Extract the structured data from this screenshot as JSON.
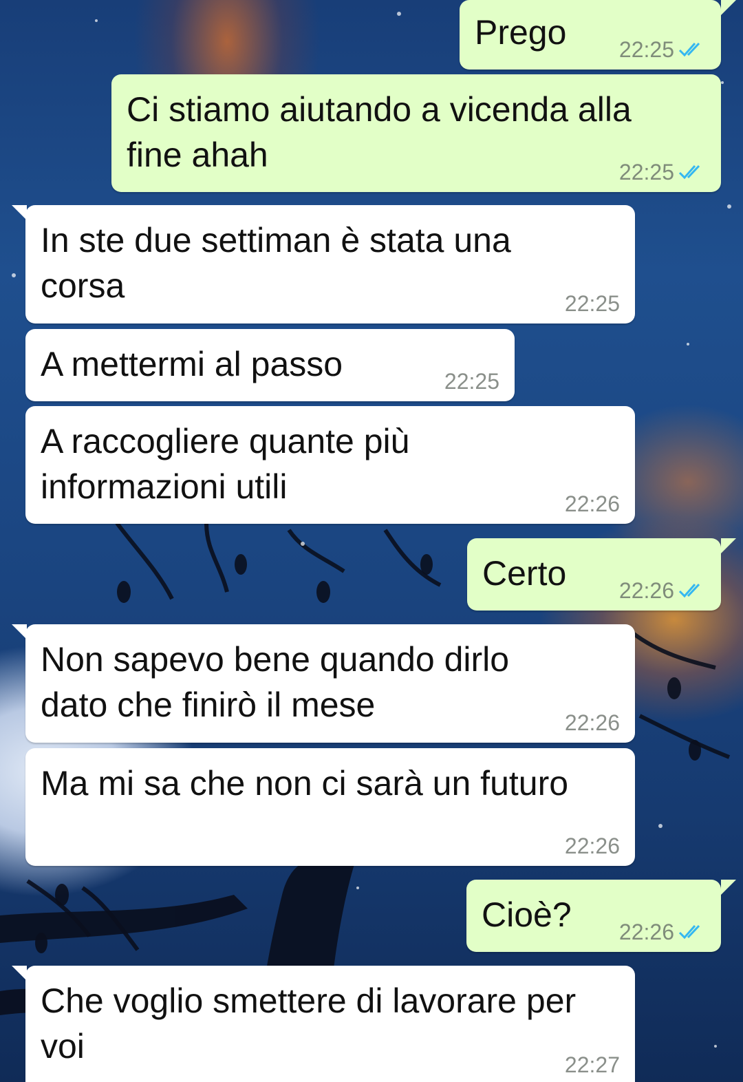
{
  "messages": [
    {
      "dir": "out",
      "text": "Prego",
      "time": "22:25",
      "status_icon": "double-check-icon"
    },
    {
      "dir": "out",
      "text": "Ci stiamo aiutando a vicenda alla\nfine ahah",
      "time": "22:25",
      "status_icon": "double-check-icon"
    },
    {
      "dir": "in",
      "text": "In ste due settiman è stata una\ncorsa",
      "time": "22:25"
    },
    {
      "dir": "in",
      "text": "A mettermi al passo",
      "time": "22:25"
    },
    {
      "dir": "in",
      "text": "A raccogliere quante più\ninformazioni utili",
      "time": "22:26"
    },
    {
      "dir": "out",
      "text": "Certo",
      "time": "22:26",
      "status_icon": "double-check-icon"
    },
    {
      "dir": "in",
      "text": "Non sapevo bene quando dirlo\ndato che finirò il mese",
      "time": "22:26"
    },
    {
      "dir": "in",
      "text": "Ma mi sa che non ci sarà un futuro",
      "time": "22:26"
    },
    {
      "dir": "out",
      "text": "Cioè?",
      "time": "22:26",
      "status_icon": "double-check-icon"
    },
    {
      "dir": "in",
      "text": "Che voglio smettere di lavorare per\nvoi",
      "time": "22:27"
    }
  ],
  "colors": {
    "outgoing_bubble": "#e2ffc7",
    "incoming_bubble": "#ffffff",
    "read_ticks": "#34b7f1"
  }
}
